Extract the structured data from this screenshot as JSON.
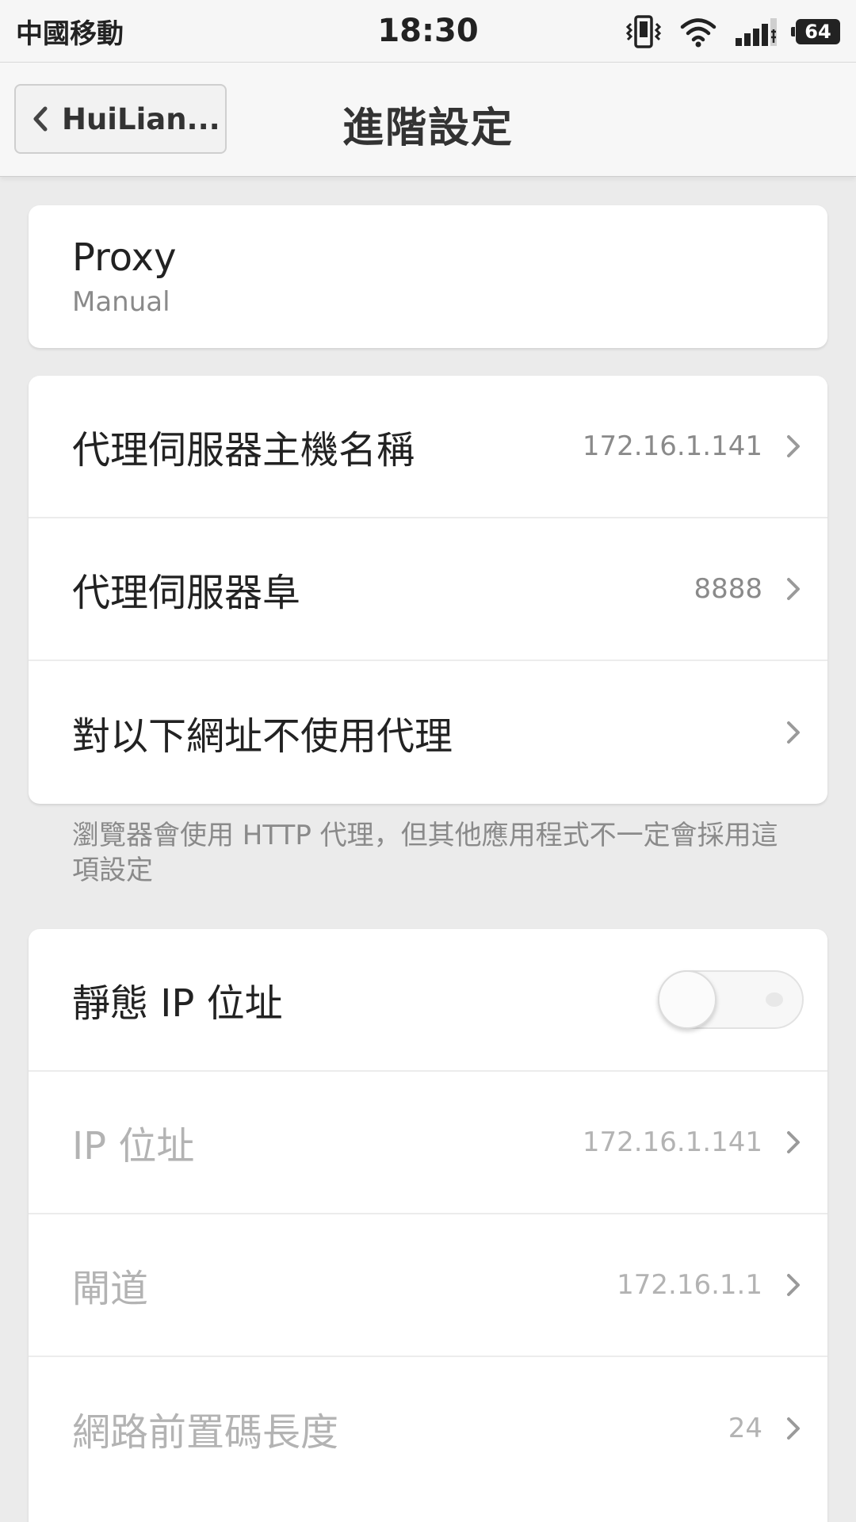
{
  "status_bar": {
    "carrier": "中國移動",
    "time": "18:30",
    "battery": "64",
    "icons": [
      "vibrate-icon",
      "wifi-icon",
      "signal-icon",
      "battery-icon"
    ]
  },
  "header": {
    "back_label": "HuiLian...",
    "title": "進階設定"
  },
  "proxy": {
    "label": "Proxy",
    "value": "Manual"
  },
  "proxy_settings": {
    "hostname": {
      "label": "代理伺服器主機名稱",
      "value": "172.16.1.141"
    },
    "port": {
      "label": "代理伺服器阜",
      "value": "8888"
    },
    "bypass": {
      "label": "對以下網址不使用代理"
    }
  },
  "note": "瀏覽器會使用 HTTP 代理，但其他應用程式不一定會採用這項設定",
  "static_ip": {
    "label": "靜態 IP 位址",
    "enabled": false,
    "ip": {
      "label": "IP 位址",
      "value": "172.16.1.141"
    },
    "gateway": {
      "label": "閘道",
      "value": "172.16.1.1"
    },
    "prefix": {
      "label": "網路前置碼長度",
      "value": "24"
    }
  },
  "colors": {
    "background": "#ebebeb",
    "card": "#ffffff",
    "primary_text": "#222222",
    "secondary_text": "#8a8a8a",
    "disabled_text": "#b3b3b3"
  }
}
